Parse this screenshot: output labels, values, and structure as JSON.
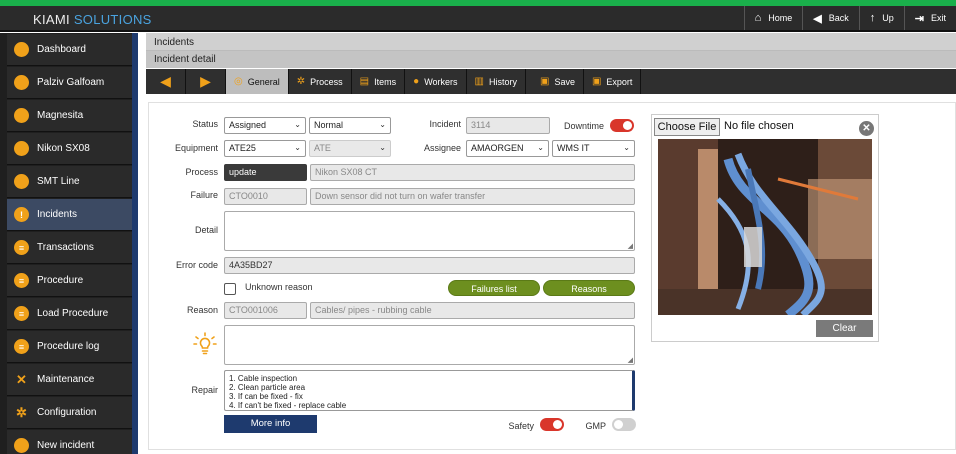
{
  "app": {
    "brand_1": "KIAMI",
    "brand_2": "SOLUTIONS"
  },
  "topnav": [
    {
      "label": "Home",
      "icon": "home-icon"
    },
    {
      "label": "Back",
      "icon": "back-arrow-icon"
    },
    {
      "label": "Up",
      "icon": "up-arrow-icon"
    },
    {
      "label": "Exit",
      "icon": "exit-icon"
    }
  ],
  "sidebar": {
    "items": [
      {
        "label": "Dashboard",
        "icon": "circle-icon"
      },
      {
        "label": "Palziv Galfoam",
        "icon": "circle-icon"
      },
      {
        "label": "Magnesita",
        "icon": "circle-icon"
      },
      {
        "label": "Nikon SX08",
        "icon": "circle-icon"
      },
      {
        "label": "SMT Line",
        "icon": "circle-icon"
      },
      {
        "label": "Incidents",
        "icon": "alert-icon",
        "active": true
      },
      {
        "label": "Transactions",
        "icon": "list-icon"
      },
      {
        "label": "Procedure",
        "icon": "list-icon"
      },
      {
        "label": "Load Procedure",
        "icon": "list-icon"
      },
      {
        "label": "Procedure log",
        "icon": "list-icon"
      },
      {
        "label": "Maintenance",
        "icon": "tools-icon"
      },
      {
        "label": "Configuration",
        "icon": "gears-icon"
      },
      {
        "label": "New incident",
        "icon": "circle-icon"
      }
    ]
  },
  "breadcrumb": {
    "level1": "Incidents",
    "level2": "Incident detail"
  },
  "toolbar": {
    "tabs": [
      {
        "label": "General",
        "icon": "general-icon",
        "selected": true
      },
      {
        "label": "Process",
        "icon": "process-icon"
      },
      {
        "label": "Items",
        "icon": "items-icon"
      },
      {
        "label": "Workers",
        "icon": "workers-icon"
      },
      {
        "label": "History",
        "icon": "history-icon"
      },
      {
        "label": "Save",
        "icon": "save-icon"
      },
      {
        "label": "Export",
        "icon": "export-icon"
      }
    ]
  },
  "form": {
    "status_label": "Status",
    "status_value": "Assigned",
    "priority_value": "Normal",
    "incident_label": "Incident",
    "incident_value": "3114",
    "downtime_label": "Downtime",
    "downtime_on": true,
    "equipment_label": "Equipment",
    "equipment_value": "ATE25",
    "equipment_type_value": "ATE",
    "assignee_label": "Assignee",
    "assignee_value": "AMAORGEN",
    "assignee_group_value": "WMS IT",
    "process_label": "Process",
    "process_value": "update",
    "process_desc": "Nikon SX08 CT",
    "failure_label": "Failure",
    "failure_code": "CTO0010",
    "failure_desc": "Down sensor did not turn on wafer transfer",
    "detail_label": "Detail",
    "error_code_label": "Error code",
    "error_code_value": "4A35BD27",
    "unknown_reason_label": "Unknown reason",
    "failures_list_label": "Failures list",
    "reasons_label": "Reasons",
    "reason_label": "Reason",
    "reason_code": "CTO001006",
    "reason_desc": "Cables/ pipes - rubbing cable",
    "repair_label": "Repair",
    "repair_lines": [
      "1. Cable inspection",
      "2. Clean particle area",
      "3. If can be fixed - fix",
      "4. If can't be fixed - replace cable"
    ],
    "more_info_label": "More info",
    "safety_label": "Safety",
    "safety_on": true,
    "gmp_label": "GMP",
    "gmp_on": false
  },
  "image_panel": {
    "choose_file_label": "Choose File",
    "no_file_label": "No file chosen",
    "clear_label": "Clear"
  },
  "colors": {
    "accent_orange": "#f0a11a",
    "toggle_on": "#d9362b",
    "pill_green": "#6d8f1f",
    "navy": "#1e3a6e",
    "top_stripe": "#1ab04b"
  }
}
